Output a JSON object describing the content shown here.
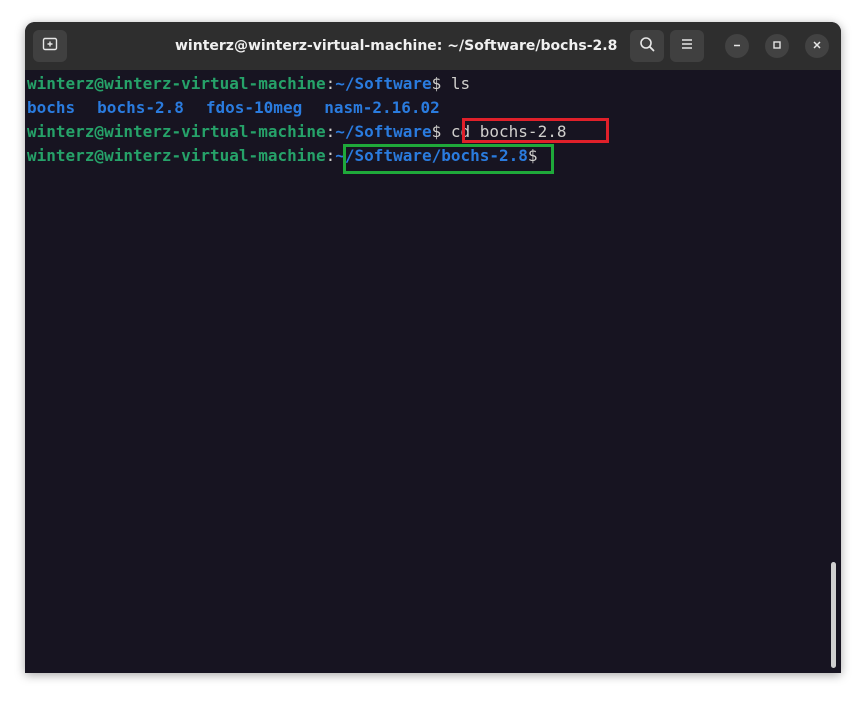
{
  "window": {
    "title": "winterz@winterz-virtual-machine: ~/Software/bochs-2.8"
  },
  "icons": {
    "new_tab": "new-tab-icon",
    "search": "search-icon",
    "menu": "hamburger-menu-icon",
    "minimize": "minimize-icon",
    "maximize": "maximize-icon",
    "close": "close-icon"
  },
  "colors": {
    "background": "#171421",
    "prompt_user": "#26a269",
    "prompt_path": "#2a7bde",
    "text": "#d0cfcc",
    "highlight_red": "#e0202a",
    "highlight_green": "#1fa93a"
  },
  "terminal": {
    "line1": {
      "user": "winterz@winterz-virtual-machine",
      "colon": ":",
      "path": "~/Software",
      "dollar": "$",
      "command": " ls"
    },
    "listing": [
      "bochs",
      "bochs-2.8",
      "fdos-10meg",
      "nasm-2.16.02"
    ],
    "line3": {
      "user": "winterz@winterz-virtual-machine",
      "colon": ":",
      "path": "~/Software",
      "dollar": "$",
      "command": " cd bochs-2.8"
    },
    "line4": {
      "user": "winterz@winterz-virtual-machine",
      "colon": ":",
      "path": "~/Software/bochs-2.8",
      "dollar": "$"
    }
  }
}
